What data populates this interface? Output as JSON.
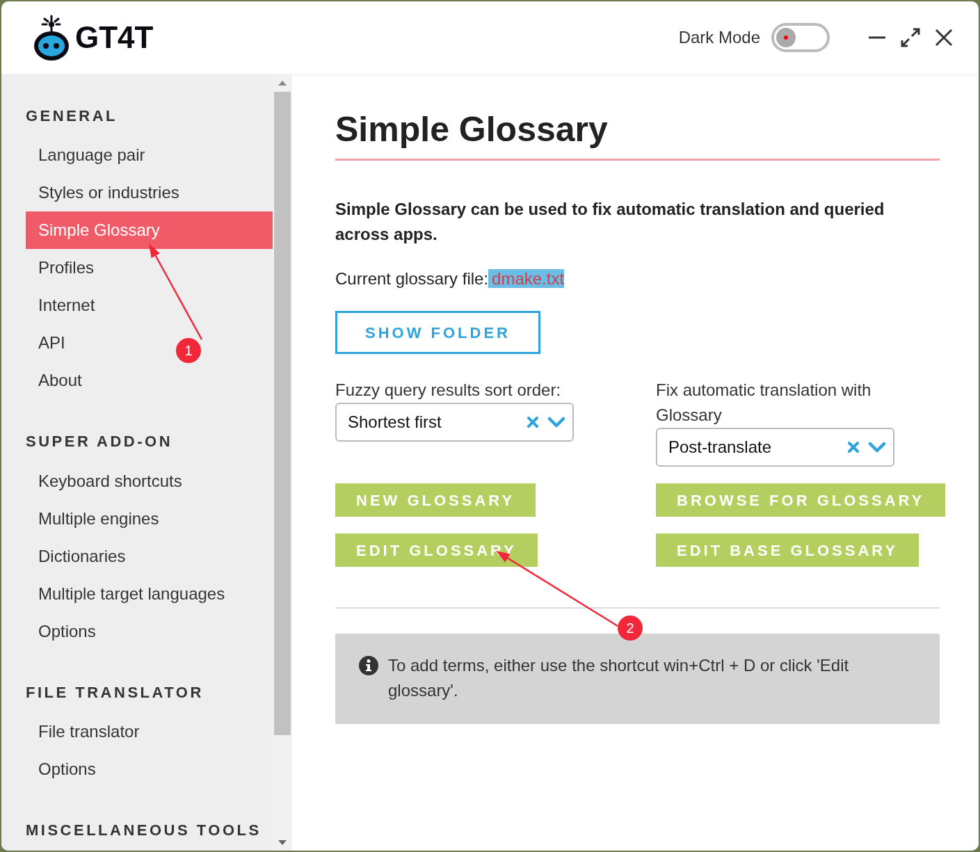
{
  "app": {
    "name": "GT4T"
  },
  "dark_mode": {
    "label": "Dark Mode",
    "on": false
  },
  "sidebar": {
    "sections": [
      {
        "title": "GENERAL",
        "items": [
          {
            "label": "Language pair",
            "selected": false
          },
          {
            "label": "Styles or industries",
            "selected": false
          },
          {
            "label": "Simple Glossary",
            "selected": true
          },
          {
            "label": "Profiles",
            "selected": false
          },
          {
            "label": "Internet",
            "selected": false
          },
          {
            "label": "API",
            "selected": false
          },
          {
            "label": "About",
            "selected": false
          }
        ]
      },
      {
        "title": "SUPER ADD-ON",
        "items": [
          {
            "label": "Keyboard shortcuts",
            "selected": false
          },
          {
            "label": "Multiple engines",
            "selected": false
          },
          {
            "label": "Dictionaries",
            "selected": false
          },
          {
            "label": "Multiple target languages",
            "selected": false
          },
          {
            "label": "Options",
            "selected": false
          }
        ]
      },
      {
        "title": "FILE TRANSLATOR",
        "items": [
          {
            "label": "File translator",
            "selected": false
          },
          {
            "label": "Options",
            "selected": false
          }
        ]
      },
      {
        "title": "MISCELLANEOUS TOOLS"
      }
    ]
  },
  "content": {
    "title": "Simple Glossary",
    "description": "Simple Glossary can be used to fix automatic translation and queried across apps.",
    "file_label": "Current glossary file:",
    "file_name": "dmake.txt",
    "show_folder": "SHOW FOLDER",
    "selects": [
      {
        "label": "Fuzzy query results sort order:",
        "value": "Shortest first"
      },
      {
        "label": "Fix automatic translation with Glossary",
        "value": "Post-translate"
      }
    ],
    "buttons": [
      "NEW GLOSSARY",
      "BROWSE FOR GLOSSARY",
      "EDIT GLOSSARY",
      "EDIT BASE GLOSSARY"
    ],
    "info": "To add terms, either use the shortcut win+Ctrl + D or click 'Edit glossary'."
  },
  "annotations": [
    {
      "label": "1"
    },
    {
      "label": "2"
    }
  ]
}
